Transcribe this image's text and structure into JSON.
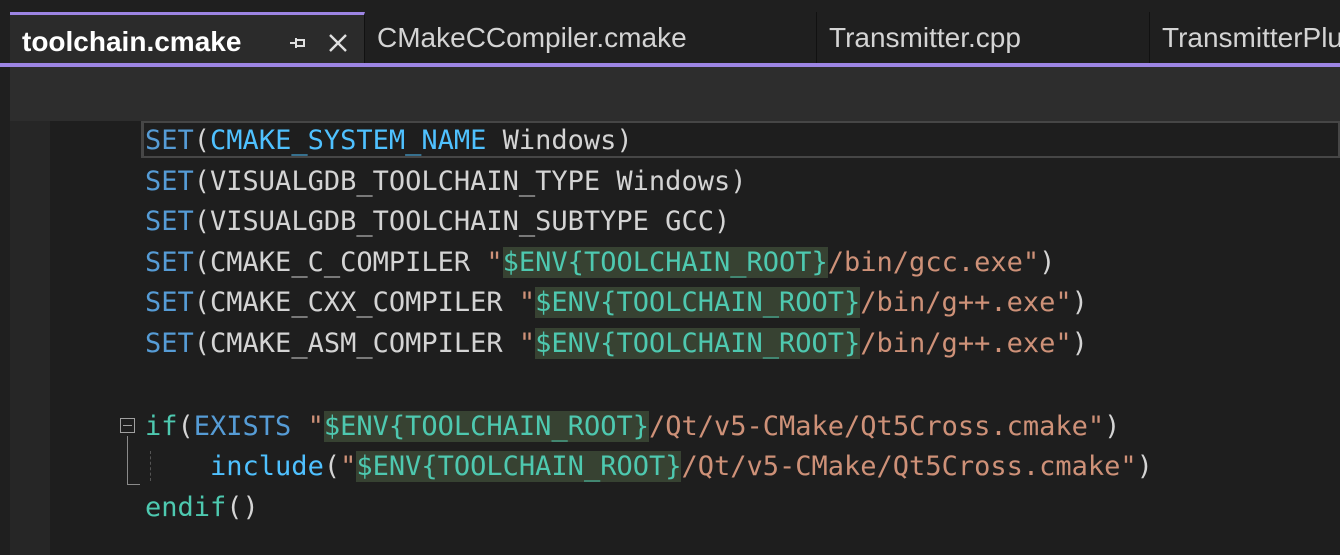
{
  "tabs": [
    {
      "label": "toolchain.cmake",
      "active": true
    },
    {
      "label": "CMakeCCompiler.cmake",
      "active": false
    },
    {
      "label": "Transmitter.cpp",
      "active": false
    },
    {
      "label": "TransmitterPlu",
      "active": false
    }
  ],
  "tab_icons": {
    "pin": "pin-icon",
    "close": "close-icon"
  },
  "code": {
    "l1": {
      "fn": "SET",
      "open": "(",
      "arg": "CMAKE_SYSTEM_NAME",
      "rest": " Windows)"
    },
    "l2": {
      "fn": "SET",
      "rest": "(VISUALGDB_TOOLCHAIN_TYPE Windows)"
    },
    "l3": {
      "fn": "SET",
      "rest": "(VISUALGDB_TOOLCHAIN_SUBTYPE GCC)"
    },
    "l4": {
      "fn": "SET",
      "pre": "(CMAKE_C_COMPILER ",
      "q": "\"",
      "sig": "$ENV{",
      "var": "TOOLCHAIN_ROOT",
      "close": "}",
      "path": "/bin/gcc.exe\"",
      "end": ")"
    },
    "l5": {
      "fn": "SET",
      "pre": "(CMAKE_CXX_COMPILER ",
      "q": "\"",
      "sig": "$ENV{",
      "var": "TOOLCHAIN_ROOT",
      "close": "}",
      "path": "/bin/g++.exe\"",
      "end": ")"
    },
    "l6": {
      "fn": "SET",
      "pre": "(CMAKE_ASM_COMPILER ",
      "q": "\"",
      "sig": "$ENV{",
      "var": "TOOLCHAIN_ROOT",
      "close": "}",
      "path": "/bin/g++.exe\"",
      "end": ")"
    },
    "l8": {
      "kw": "if",
      "open": "(",
      "exists": "EXISTS",
      "sp": " ",
      "q": "\"",
      "sig": "$ENV{",
      "var": "TOOLCHAIN_ROOT",
      "close": "}",
      "path": "/Qt/v5-CMake/Qt5Cross.cmake\"",
      "end": ")"
    },
    "l9": {
      "indent": "    ",
      "fn": "include",
      "open": "(",
      "q": "\"",
      "sig": "$ENV{",
      "var": "TOOLCHAIN_ROOT",
      "close": "}",
      "path": "/Qt/v5-CMake/Qt5Cross.cmake\"",
      "end": ")"
    },
    "l10": {
      "kw": "endif",
      "rest": "()"
    }
  },
  "colors": {
    "accent": "#9d85e4",
    "keyword": "#569cd6",
    "variable": "#4fc1ff",
    "string": "#ce9178",
    "env": "#4ec9b0"
  }
}
